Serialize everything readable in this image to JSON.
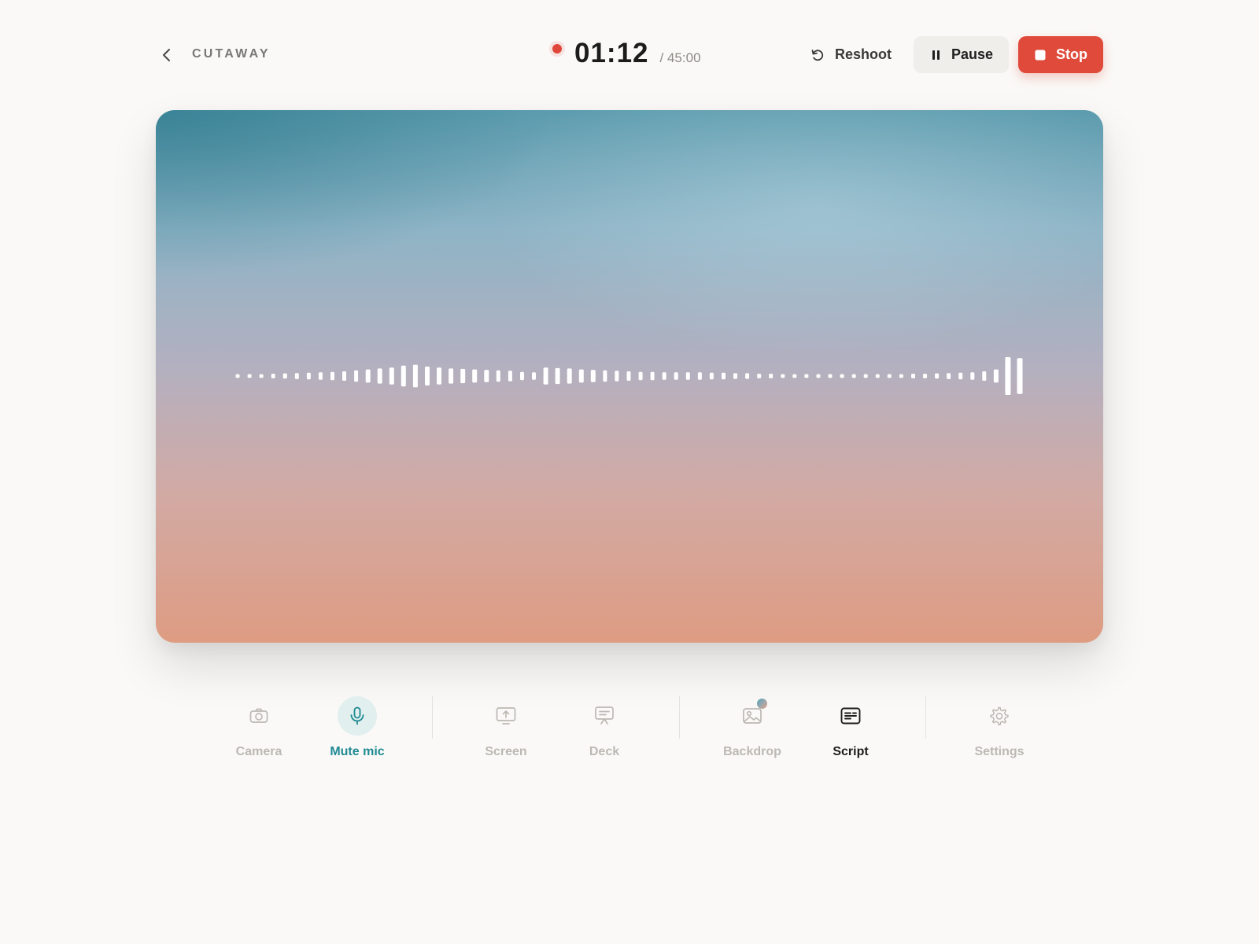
{
  "app": {
    "brand": "CUTAWAY"
  },
  "recording": {
    "elapsed": "01:12",
    "total": "/ 45:00",
    "status_color": "#e0473b"
  },
  "header_actions": {
    "reshoot_label": "Reshoot",
    "pause_label": "Pause",
    "stop_label": "Stop"
  },
  "stage": {
    "waveform_levels": [
      0.1,
      0.1,
      0.1,
      0.12,
      0.14,
      0.16,
      0.18,
      0.2,
      0.22,
      0.25,
      0.3,
      0.35,
      0.4,
      0.45,
      0.55,
      0.6,
      0.5,
      0.45,
      0.4,
      0.38,
      0.35,
      0.32,
      0.3,
      0.28,
      0.22,
      0.2,
      0.45,
      0.42,
      0.4,
      0.35,
      0.32,
      0.3,
      0.28,
      0.25,
      0.22,
      0.22,
      0.2,
      0.2,
      0.2,
      0.2,
      0.18,
      0.18,
      0.15,
      0.15,
      0.12,
      0.12,
      0.1,
      0.1,
      0.1,
      0.1,
      0.1,
      0.1,
      0.1,
      0.1,
      0.1,
      0.1,
      0.1,
      0.12,
      0.12,
      0.14,
      0.16,
      0.18,
      0.2,
      0.25,
      0.35,
      1.0,
      0.95
    ],
    "waveform_color": "#ffffff"
  },
  "toolbar": {
    "camera": {
      "label": "Camera",
      "icon": "camera-icon"
    },
    "mic": {
      "label": "Mute mic",
      "icon": "microphone-icon"
    },
    "screen": {
      "label": "Screen",
      "icon": "screen-share-icon"
    },
    "deck": {
      "label": "Deck",
      "icon": "presentation-icon"
    },
    "backdrop": {
      "label": "Backdrop",
      "icon": "image-icon"
    },
    "script": {
      "label": "Script",
      "icon": "script-icon"
    },
    "settings": {
      "label": "Settings",
      "icon": "gear-icon"
    }
  },
  "colors": {
    "accent": "#1f8a92",
    "stop": "#df4a3b",
    "background": "#faf9f7"
  }
}
